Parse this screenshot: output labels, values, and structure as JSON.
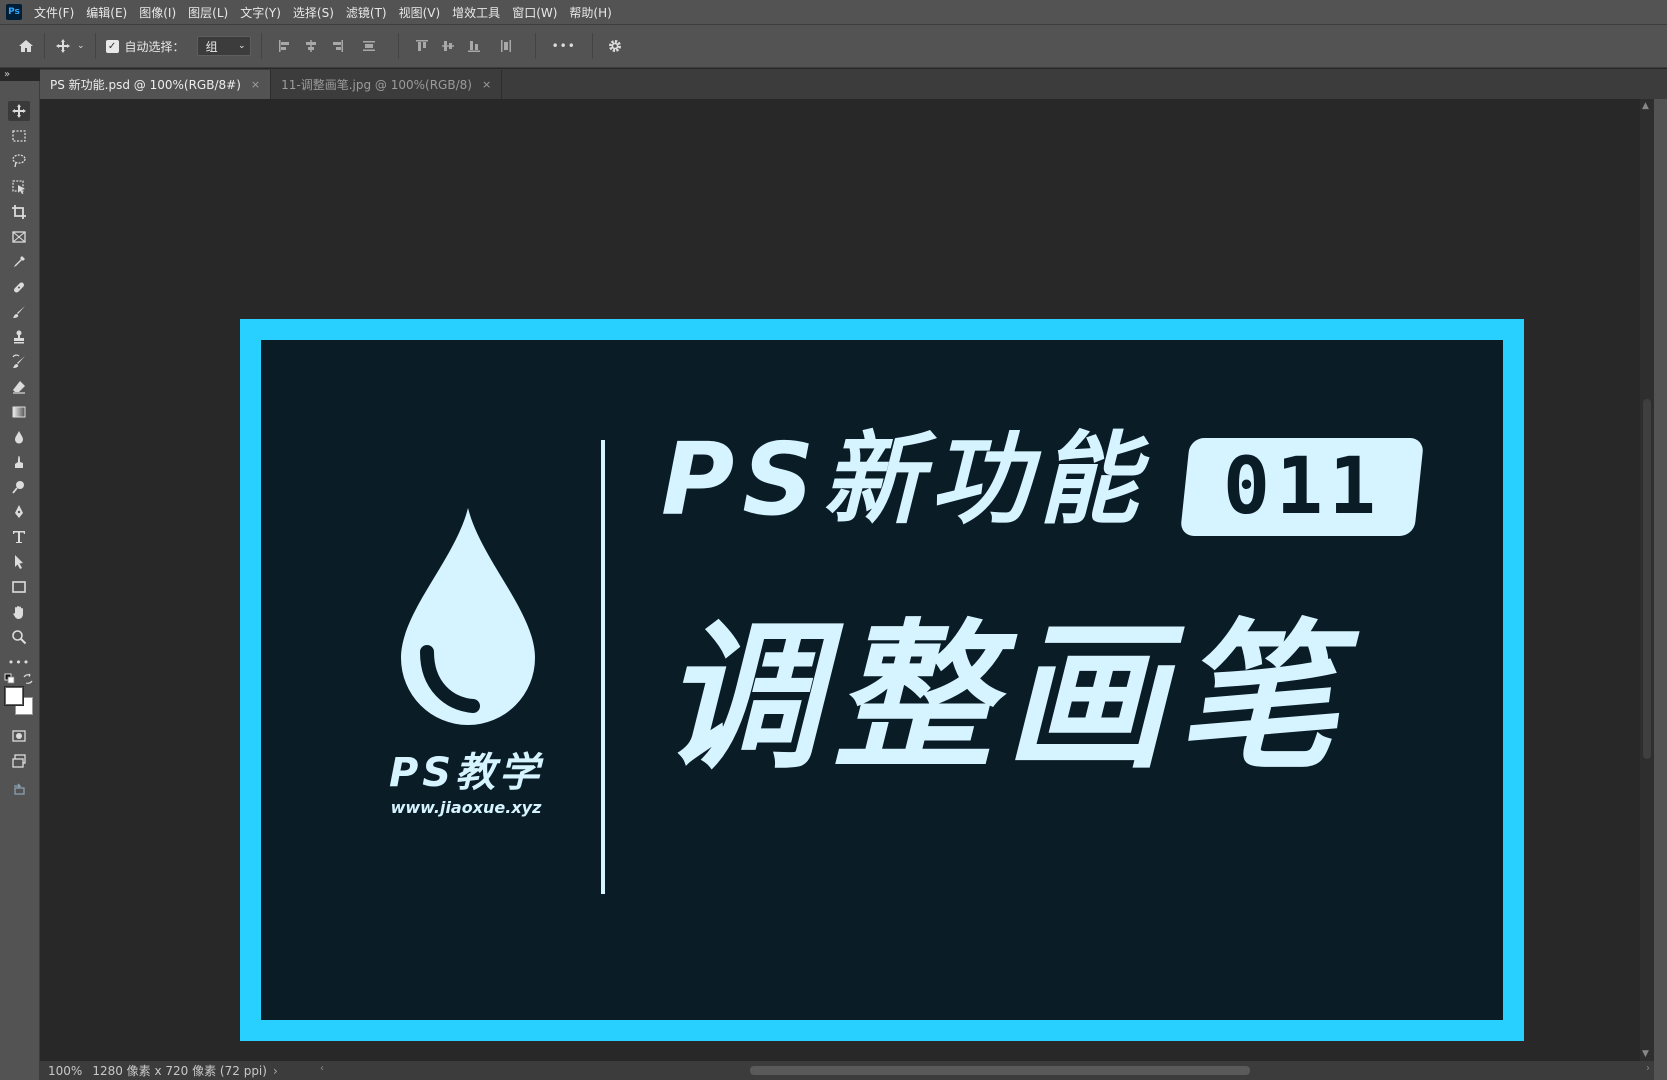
{
  "app": {
    "logo_text": "Ps"
  },
  "menu": [
    "文件(F)",
    "编辑(E)",
    "图像(I)",
    "图层(L)",
    "文字(Y)",
    "选择(S)",
    "滤镜(T)",
    "视图(V)",
    "增效工具",
    "窗口(W)",
    "帮助(H)"
  ],
  "options_bar": {
    "auto_select_label": "自动选择：",
    "auto_select_checked": true,
    "group_value": "组",
    "more_label": "•••"
  },
  "panel_collapse_glyph": "»",
  "tabs": [
    {
      "label": "PS 新功能.psd @ 100%(RGB/8#)",
      "active": true,
      "close": "×"
    },
    {
      "label": "11-调整画笔.jpg @ 100%(RGB/8)",
      "active": false,
      "close": "×"
    }
  ],
  "artwork": {
    "brand_title": "PS教学",
    "brand_url": "www.jiaoxue.xyz",
    "headline": "PS新功能",
    "episode_number": "011",
    "main_title": "调整画笔",
    "border_color": "#28d0ff",
    "background_color": "#0a1d27",
    "text_color": "#d6f4ff"
  },
  "status": {
    "zoom": "100%",
    "doc_info": "1280 像素 x 720 像素 (72 ppi)",
    "arrow": "›"
  }
}
